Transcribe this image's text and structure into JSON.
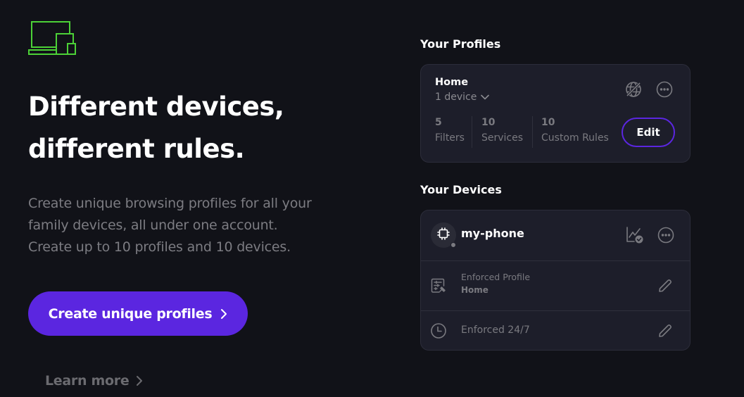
{
  "hero": {
    "logo_icon": "devices-icon",
    "headline_line1": "Different devices,",
    "headline_line2": "different rules.",
    "description_lines": [
      "Create unique browsing profiles for all your",
      "family devices, all under one account.",
      "Create up to 10 profiles and 10 devices."
    ],
    "cta_label": "Create unique profiles",
    "learn_more_label": "Learn more"
  },
  "profiles": {
    "title": "Your  Profiles",
    "card": {
      "name": "Home",
      "devices": "1 device",
      "stats": [
        {
          "value": "5",
          "label": "Filters"
        },
        {
          "value": "10",
          "label": "Services"
        },
        {
          "value": "10",
          "label": "Custom Rules"
        }
      ],
      "edit_label": "Edit"
    }
  },
  "devices": {
    "title": "Your Devices",
    "card": {
      "name": "my-phone",
      "enforced_profile_label": "Enforced Profile",
      "enforced_profile_value": "Home",
      "schedule_text": "Enforced 24/7"
    }
  },
  "colors": {
    "background": "#111218",
    "accent": "#5b26e0",
    "logo_green": "#4cd137",
    "card_bg": "#1d1e2a",
    "muted_text": "#7a7a80"
  }
}
